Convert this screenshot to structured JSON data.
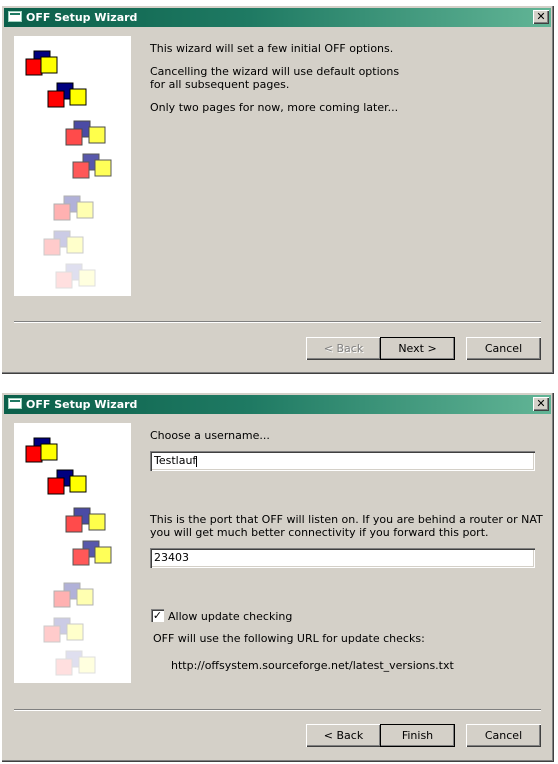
{
  "wizard1": {
    "title": "OFF Setup Wizard",
    "close_glyph": "✕",
    "intro_lines": [
      "This wizard will set a few initial OFF options.",
      "Cancelling the wizard will use default options\nfor all subsequent pages.",
      "Only two pages for now, more coming later..."
    ],
    "buttons": {
      "back": "< Back",
      "next": "Next >",
      "cancel": "Cancel"
    }
  },
  "wizard2": {
    "title": "OFF Setup Wizard",
    "close_glyph": "✕",
    "username_label": "Choose a username...",
    "username_value": "Testlauf",
    "port_label": "This is the port that OFF will listen on. If you are behind a router or NAT\nyou will get much better connectivity if you forward this port.",
    "port_value": "23403",
    "update_checkbox_label": "Allow update checking",
    "update_checked": true,
    "url_info_label": "OFF will use the following URL for update checks:",
    "url_value": "http://offsystem.sourceforge.net/latest_versions.txt",
    "buttons": {
      "back": "< Back",
      "finish": "Finish",
      "cancel": "Cancel"
    }
  },
  "icons": {
    "logo": "off-blocks-logo-icon",
    "window": "window-icon",
    "close": "close-icon"
  }
}
